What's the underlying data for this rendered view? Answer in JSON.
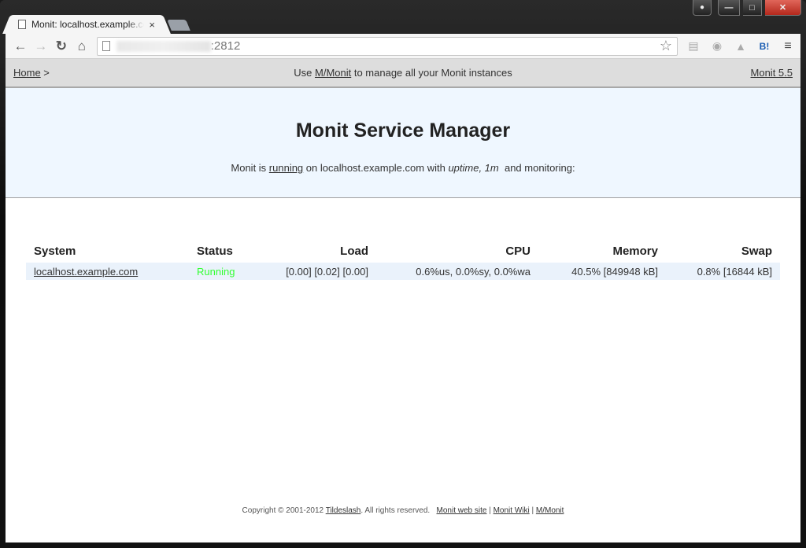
{
  "browser": {
    "tab_title": "Monit: localhost.example.com",
    "tab_close": "×",
    "url_port": ":2812",
    "icons": {
      "back": "←",
      "forward": "→",
      "reload": "↻",
      "home": "⌂",
      "star": "☆",
      "reader": "▤",
      "camera": "◉",
      "drive": "▲",
      "hatena": "B!",
      "menu": "≡",
      "profile": "👤",
      "minimize": "—",
      "maximize": "□",
      "close": "✕"
    }
  },
  "navbar": {
    "home_label": "Home",
    "separator": " >",
    "center_prefix": "Use ",
    "center_link": "M/Monit",
    "center_suffix": " to manage all your Monit instances",
    "version_link": "Monit 5.5"
  },
  "header": {
    "title": "Monit Service Manager",
    "status_prefix": "Monit is ",
    "status_link": "running",
    "status_middle": " on localhost.example.com with ",
    "uptime_label": "uptime, 1m",
    "status_suffix": "  and monitoring:"
  },
  "table": {
    "columns": [
      "System",
      "Status",
      "Load",
      "CPU",
      "Memory",
      "Swap"
    ],
    "rows": [
      {
        "system": "localhost.example.com",
        "status": "Running",
        "load": "[0.00] [0.02] [0.00]",
        "cpu": "0.6%us, 0.0%sy, 0.0%wa",
        "memory": "40.5% [849948 kB]",
        "swap": "0.8% [16844 kB]"
      }
    ],
    "status_color": "#33ff33",
    "row_bg": "#eaf2fb"
  },
  "footer": {
    "copyright": "Copyright © 2001-2012 ",
    "company_link": "Tildeslash",
    "rights": ". All rights reserved.   ",
    "link_website": "Monit web site",
    "sep1": " | ",
    "link_wiki": "Monit Wiki",
    "sep2": " | ",
    "link_mmonit": "M/Monit"
  },
  "colors": {
    "header_bg": "#eff7ff",
    "navbar_bg": "#dddddd"
  }
}
